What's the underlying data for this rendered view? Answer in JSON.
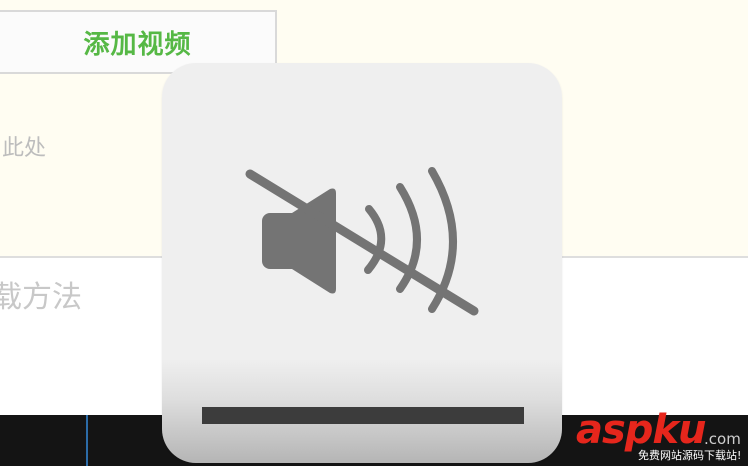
{
  "background": {
    "add_video_button_label": "添加视频",
    "drop_hint_text": "此处",
    "method_text": "载方法"
  },
  "osd": {
    "state": "muted",
    "icon": "speaker-muted-icon",
    "volume_level": 0
  },
  "taskbar": {},
  "watermark": {
    "main": "aspku",
    "dotcom": ".com",
    "subtitle": "免费网站源码下载站!"
  },
  "colors": {
    "accent_green": "#56b845",
    "panel_bg": "#fffdf2",
    "osd_bg": "#efefef",
    "icon_gray": "#747474",
    "taskbar": "#141414",
    "watermark_red": "#e6261c"
  }
}
